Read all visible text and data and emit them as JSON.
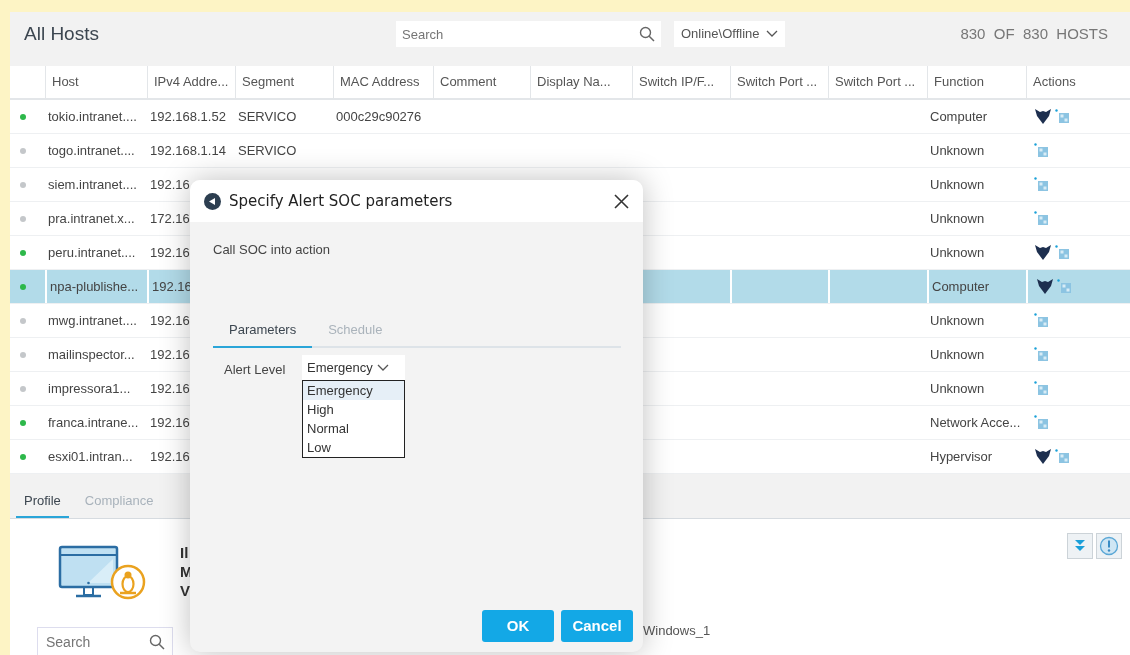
{
  "header": {
    "title": "All Hosts",
    "search": {
      "placeholder": "Search"
    },
    "filter": "Online\\Offline",
    "count": "830  OF  830  HOSTS"
  },
  "table": {
    "columns": [
      "Host",
      "IPv4 Addre...",
      "Segment",
      "MAC Address",
      "Comment",
      "Display Na...",
      "Switch IP/F...",
      "Switch Port ...",
      "Switch Port ...",
      "Function",
      "Actions"
    ],
    "rows": [
      {
        "online": true,
        "selected": false,
        "host": "tokio.intranet....",
        "ip": "192.168.1.52",
        "segment": "SERVICO",
        "mac": "000c29c90276",
        "function": "Computer",
        "managed": true
      },
      {
        "online": false,
        "selected": false,
        "host": "togo.intranet....",
        "ip": "192.168.1.14",
        "segment": "SERVICO",
        "function": "Unknown",
        "managed": false
      },
      {
        "online": false,
        "selected": false,
        "host": "siem.intranet....",
        "ip": "192.16",
        "function": "Unknown",
        "managed": false
      },
      {
        "online": false,
        "selected": false,
        "host": "pra.intranet.x...",
        "ip": "172.16",
        "function": "Unknown",
        "managed": false
      },
      {
        "online": true,
        "selected": false,
        "host": "peru.intranet....",
        "ip": "192.16",
        "function": "Unknown",
        "managed": true
      },
      {
        "online": true,
        "selected": true,
        "host": "npa-plublishe...",
        "ip": "192.16",
        "function": "Computer",
        "managed": true
      },
      {
        "online": false,
        "selected": false,
        "host": "mwg.intranet....",
        "ip": "192.16",
        "function": "Unknown",
        "managed": false
      },
      {
        "online": false,
        "selected": false,
        "host": "mailinspector...",
        "ip": "192.16",
        "function": "Unknown",
        "managed": false
      },
      {
        "online": false,
        "selected": false,
        "host": "impressora1...",
        "ip": "192.16",
        "function": "Unknown",
        "managed": false
      },
      {
        "online": true,
        "selected": false,
        "host": "franca.intrane...",
        "ip": "192.16",
        "function": "Network Acce...",
        "managed": false
      },
      {
        "online": true,
        "selected": false,
        "host": "esxi01.intran...",
        "ip": "192.16",
        "function": "Hypervisor",
        "managed": true
      }
    ]
  },
  "details": {
    "tabs": [
      {
        "label": "Profile",
        "selected": true
      },
      {
        "label": "Compliance",
        "selected": false
      }
    ],
    "profile_lines": [
      "Il",
      "M",
      "V"
    ],
    "search": {
      "placeholder": "Search"
    },
    "os_label": "Windows_1"
  },
  "dialog": {
    "title": "Specify Alert SOC parameters",
    "description": "Call SOC into action",
    "tabs": [
      {
        "label": "Parameters",
        "selected": true
      },
      {
        "label": "Schedule",
        "selected": false
      }
    ],
    "alert_level": {
      "label": "Alert Level",
      "value": "Emergency",
      "expanded": true,
      "options": [
        {
          "label": "Emergency",
          "selected": true
        },
        {
          "label": "High",
          "selected": false
        },
        {
          "label": "Normal",
          "selected": false
        },
        {
          "label": "Low",
          "selected": false
        }
      ]
    },
    "buttons": [
      "OK",
      "Cancel"
    ]
  }
}
